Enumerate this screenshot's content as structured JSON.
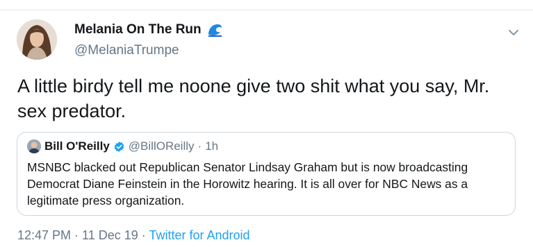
{
  "tweet": {
    "display_name": "Melania On The Run",
    "name_emoji_icon": "water-wave-icon",
    "handle": "@MelaniaTrumpe",
    "text": "A little birdy tell me noone give two shit what you say, Mr. sex predator.",
    "time": "12:47 PM · 11 Dec 19",
    "separator": " · ",
    "source": "Twitter for Android"
  },
  "quote": {
    "display_name": "Bill O'Reilly",
    "verified_icon": "verified-badge-icon",
    "handle": "@BillOReilly",
    "separator": "·",
    "time": "1h",
    "text": "MSNBC blacked out Republican Senator Lindsay Graham but is now broadcasting Democrat Diane Feinstein in the Horowitz hearing.  It is all over for NBC News as a legitimate press organization."
  },
  "colors": {
    "accent": "#1da1f2",
    "secondary_text": "#657786",
    "border": "#ccd6dd",
    "wave_blue": "#1e88e5"
  }
}
